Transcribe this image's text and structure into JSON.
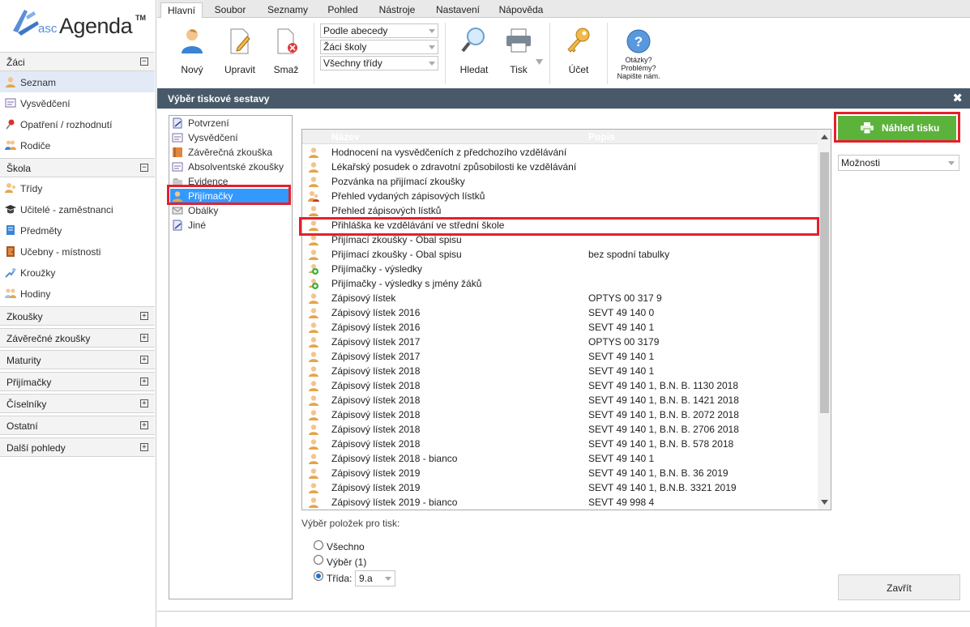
{
  "app": {
    "logo_prefix": "asc",
    "logo_name": "Agenda",
    "logo_tm": "TM"
  },
  "sidebar": {
    "sections": [
      {
        "label": "Žáci",
        "toggle": "−"
      },
      {
        "label": "Škola",
        "toggle": "−"
      },
      {
        "label": "Zkoušky",
        "toggle": "+"
      },
      {
        "label": "Závěrečné zkoušky",
        "toggle": "+"
      },
      {
        "label": "Maturity",
        "toggle": "+"
      },
      {
        "label": "Přijímačky",
        "toggle": "+"
      },
      {
        "label": "Číselníky",
        "toggle": "+"
      },
      {
        "label": "Ostatní",
        "toggle": "+"
      },
      {
        "label": "Další pohledy",
        "toggle": "+"
      }
    ],
    "zaci_items": [
      {
        "label": "Seznam",
        "icon": "user-icon"
      },
      {
        "label": "Vysvědčení",
        "icon": "certificate-icon"
      },
      {
        "label": "Opatření / rozhodnutí",
        "icon": "pin-icon"
      },
      {
        "label": "Rodiče",
        "icon": "parents-icon"
      }
    ],
    "skola_items": [
      {
        "label": "Třídy",
        "icon": "class-icon"
      },
      {
        "label": "Učitelé - zaměstnanci",
        "icon": "graduation-cap-icon"
      },
      {
        "label": "Předměty",
        "icon": "subject-icon"
      },
      {
        "label": "Učebny - místnosti",
        "icon": "door-icon"
      },
      {
        "label": "Kroužky",
        "icon": "puzzle-icon"
      },
      {
        "label": "Hodiny",
        "icon": "lessons-icon"
      }
    ]
  },
  "tabs": [
    "Hlavní",
    "Soubor",
    "Seznamy",
    "Pohled",
    "Nástroje",
    "Nastavení",
    "Nápověda"
  ],
  "toolbar": {
    "new": "Nový",
    "edit": "Upravit",
    "delete": "Smaž",
    "sort_select": "Podle abecedy",
    "scope_select": "Žáci školy",
    "class_select": "Všechny třídy",
    "search": "Hledat",
    "print": "Tisk",
    "account": "Účet",
    "help_line1": "Otázky?",
    "help_line2": "Problémy?",
    "help_line3": "Napište nám."
  },
  "dialog": {
    "title": "Výběr tiskové sestavy",
    "close": "✖",
    "categories": [
      {
        "label": "Potvrzení",
        "icon": "stamp-icon"
      },
      {
        "label": "Vysvědčení",
        "icon": "certificate-icon"
      },
      {
        "label": "Závěrečná zkouška",
        "icon": "book-icon"
      },
      {
        "label": "Absolventské zkoušky",
        "icon": "certificate-icon"
      },
      {
        "label": "Evidence",
        "icon": "folder-icon"
      },
      {
        "label": "Přijímačky",
        "icon": "user-icon"
      },
      {
        "label": "Obálky",
        "icon": "envelope-icon"
      },
      {
        "label": "Jiné",
        "icon": "stamp-icon"
      }
    ],
    "columns": {
      "name": "Název",
      "desc": "Popis"
    },
    "rows": [
      {
        "name": "Hodnocení na vysvědčeních z předchozího vzdělávání",
        "desc": "",
        "icon": "user-icon"
      },
      {
        "name": "Lékařský posudek o zdravotní způsobilosti ke vzdělávání",
        "desc": "",
        "icon": "user-icon"
      },
      {
        "name": "Pozvánka na přijímací zkoušky",
        "desc": "",
        "icon": "user-icon"
      },
      {
        "name": "Přehled vydaných zápisových lístků",
        "desc": "",
        "icon": "users-icon"
      },
      {
        "name": "Přehled zápisových lístků",
        "desc": "",
        "icon": "user-icon"
      },
      {
        "name": "Přihláška ke vzdělávání ve střední škole",
        "desc": "",
        "icon": "user-icon"
      },
      {
        "name": "Přijímací zkoušky - Obal spisu",
        "desc": "",
        "icon": "user-icon"
      },
      {
        "name": "Přijímací zkoušky - Obal spisu",
        "desc": "bez spodní tabulky",
        "icon": "user-icon"
      },
      {
        "name": "Přijímačky - výsledky",
        "desc": "",
        "icon": "user-plus-icon"
      },
      {
        "name": "Přijímačky - výsledky s jmény žáků",
        "desc": "",
        "icon": "user-plus-icon"
      },
      {
        "name": "Zápisový lístek",
        "desc": "OPTYS 00 317 9",
        "icon": "user-icon"
      },
      {
        "name": "Zápisový lístek 2016",
        "desc": "SEVT 49 140 0",
        "icon": "user-icon"
      },
      {
        "name": "Zápisový lístek 2016",
        "desc": "SEVT 49 140 1",
        "icon": "user-icon"
      },
      {
        "name": "Zápisový lístek 2017",
        "desc": "OPTYS 00 3179",
        "icon": "user-icon"
      },
      {
        "name": "Zápisový lístek 2017",
        "desc": "SEVT 49 140 1",
        "icon": "user-icon"
      },
      {
        "name": "Zápisový lístek 2018",
        "desc": "SEVT 49 140 1",
        "icon": "user-icon"
      },
      {
        "name": "Zápisový lístek 2018",
        "desc": "SEVT 49 140 1, B.N. B. 1130 2018",
        "icon": "user-icon"
      },
      {
        "name": "Zápisový lístek 2018",
        "desc": "SEVT 49 140 1, B.N. B. 1421 2018",
        "icon": "user-icon"
      },
      {
        "name": "Zápisový lístek 2018",
        "desc": "SEVT 49 140 1, B.N. B. 2072 2018",
        "icon": "user-icon"
      },
      {
        "name": "Zápisový lístek 2018",
        "desc": "SEVT 49 140 1, B.N. B. 2706 2018",
        "icon": "user-icon"
      },
      {
        "name": "Zápisový lístek 2018",
        "desc": "SEVT 49 140 1, B.N. B. 578 2018",
        "icon": "user-icon"
      },
      {
        "name": "Zápisový lístek 2018 - bianco",
        "desc": "SEVT 49 140 1",
        "icon": "user-icon"
      },
      {
        "name": "Zápisový lístek 2019",
        "desc": "SEVT 49 140 1, B.N. B. 36 2019",
        "icon": "user-icon"
      },
      {
        "name": "Zápisový lístek 2019",
        "desc": "SEVT 49 140 1, B.N.B. 3321 2019",
        "icon": "user-icon"
      },
      {
        "name": "Zápisový lístek 2019 - bianco",
        "desc": "SEVT 49 998 4",
        "icon": "user-icon"
      }
    ],
    "print_selection_label": "Výběr položek pro tisk:",
    "opt_all": "Všechno",
    "opt_selection": "Výběr (1)",
    "opt_class": "Třída:",
    "class_value": "9.a",
    "preview_button": "Náhled tisku",
    "options_select": "Možnosti",
    "close_button": "Zavřít"
  },
  "colors": {
    "accent_green": "#5cb33c",
    "highlight_red": "#e3202c",
    "dialog_bar": "#485a69",
    "selection_blue": "#3399ff"
  }
}
